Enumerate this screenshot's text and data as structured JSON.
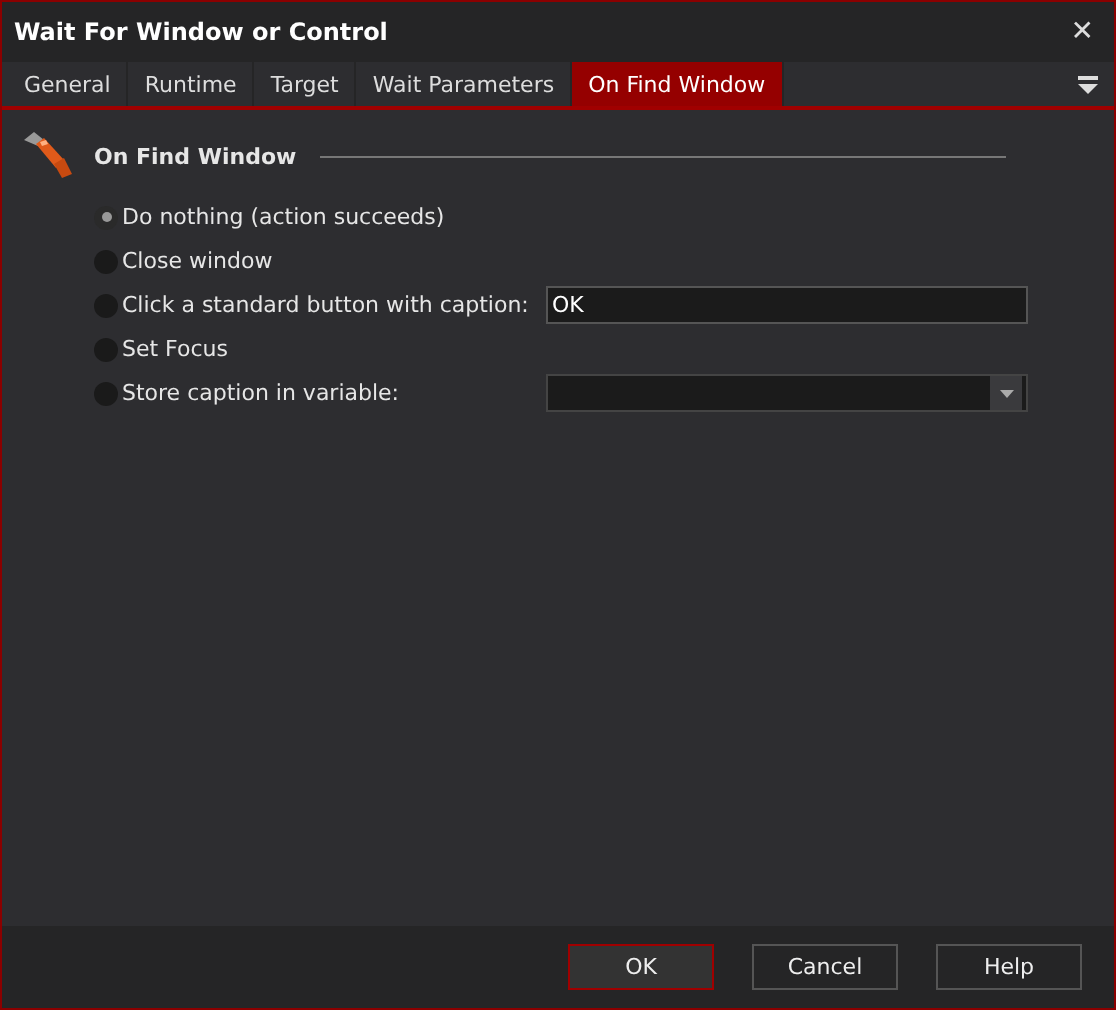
{
  "window": {
    "title": "Wait For Window or Control",
    "close": "✕"
  },
  "tabs": [
    {
      "label": "General",
      "selected": false
    },
    {
      "label": "Runtime",
      "selected": false
    },
    {
      "label": "Target",
      "selected": false
    },
    {
      "label": "Wait Parameters",
      "selected": false
    },
    {
      "label": "On Find Window",
      "selected": true
    }
  ],
  "section": {
    "title": "On Find Window"
  },
  "options": [
    {
      "label": "Do nothing (action succeeds)",
      "selected": true
    },
    {
      "label": "Close window",
      "selected": false
    },
    {
      "label": "Click a standard button with caption:",
      "selected": false,
      "field": {
        "kind": "text",
        "value": "OK"
      }
    },
    {
      "label": "Set Focus",
      "selected": false
    },
    {
      "label": "Store caption in variable:",
      "selected": false,
      "field": {
        "kind": "combo"
      }
    }
  ],
  "buttons": [
    {
      "label": "OK",
      "default": true
    },
    {
      "label": "Cancel",
      "default": false
    },
    {
      "label": "Help",
      "default": false
    }
  ]
}
